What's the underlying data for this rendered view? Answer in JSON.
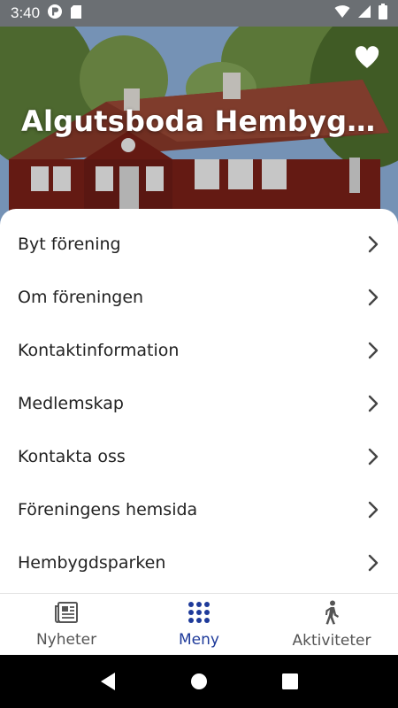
{
  "status_bar": {
    "time": "3:40"
  },
  "hero": {
    "title": "Algutsboda Hembygd..."
  },
  "menu": {
    "items": [
      {
        "label": "Byt förening"
      },
      {
        "label": "Om föreningen"
      },
      {
        "label": "Kontaktinformation"
      },
      {
        "label": "Medlemskap"
      },
      {
        "label": "Kontakta oss"
      },
      {
        "label": "Föreningens hemsida"
      },
      {
        "label": "Hembygdsparken"
      }
    ]
  },
  "bottom_nav": {
    "tabs": [
      {
        "label": "Nyheter",
        "icon": "newspaper-icon",
        "active": false
      },
      {
        "label": "Meny",
        "icon": "grid-dots-icon",
        "active": true
      },
      {
        "label": "Aktiviteter",
        "icon": "walking-person-icon",
        "active": false
      }
    ]
  },
  "colors": {
    "accent": "#1e3a9a",
    "status_bar": "#6b6f73"
  }
}
